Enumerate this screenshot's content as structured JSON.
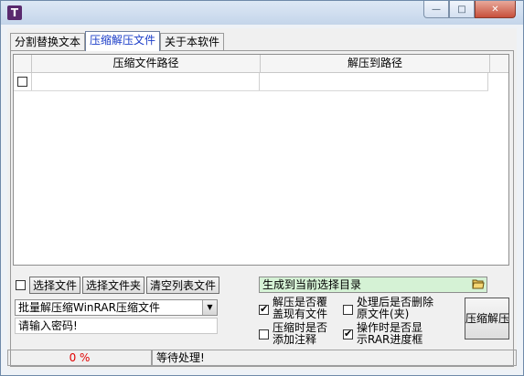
{
  "window": {
    "title": "",
    "icon_letter": "T",
    "controls": {
      "minimize": "—",
      "maximize": "□",
      "close": "✕"
    }
  },
  "tabs": [
    {
      "label": "分割替换文本",
      "active": false
    },
    {
      "label": "压缩解压文件",
      "active": true
    },
    {
      "label": "关于本软件",
      "active": false
    }
  ],
  "grid": {
    "columns": [
      "压缩文件路径",
      "解压到路径"
    ],
    "rows": [
      {
        "checked": false,
        "archive_path": "",
        "extract_path": ""
      }
    ]
  },
  "left_controls": {
    "select_file": "选择文件",
    "select_folder": "选择文件夹",
    "clear_list": "清空列表文件",
    "mode_select": "批量解压缩WinRAR压缩文件",
    "password_placeholder": "请输入密码!"
  },
  "right_controls": {
    "output_dir": "生成到当前选择目录",
    "overwrite_line1": "解压是否覆",
    "overwrite_line2": "盖现有文件",
    "overwrite_checked": true,
    "comment_line1": "压缩时是否",
    "comment_line2": "添加注释",
    "comment_checked": false,
    "delete_line1": "处理后是否删除",
    "delete_line2": "原文件(夹)",
    "delete_checked": false,
    "progress_line1": "操作时是否显",
    "progress_line2": "示RAR进度框",
    "progress_checked": true,
    "run_button": "压缩解压"
  },
  "status": {
    "percent": "0 %",
    "message": "等待处理!"
  },
  "colors": {
    "output_dir_bg": "#d5f2d5",
    "active_tab_text": "#1a3cc8",
    "percent_text": "#e00000"
  }
}
